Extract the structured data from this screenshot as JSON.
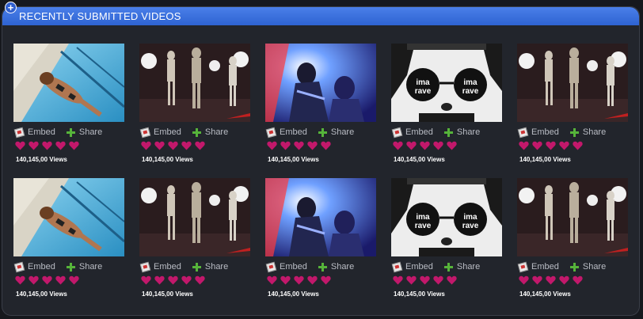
{
  "panel": {
    "title": "RECENTLY SUBMITTED VIDEOS",
    "header_color": "#3b70de",
    "expand_icon": "plus-icon"
  },
  "videos": [
    {
      "thumb": "pool",
      "embed_label": "Embed",
      "share_label": "Share",
      "rating": 5,
      "views": "140,145,00 Views"
    },
    {
      "thumb": "stage",
      "embed_label": "Embed",
      "share_label": "Share",
      "rating": 5,
      "views": "140,145,00 Views"
    },
    {
      "thumb": "club",
      "embed_label": "Embed",
      "share_label": "Share",
      "rating": 5,
      "views": "140,145,00 Views"
    },
    {
      "thumb": "rave",
      "embed_label": "Embed",
      "share_label": "Share",
      "rating": 5,
      "views": "140,145,00 Views"
    },
    {
      "thumb": "stage",
      "embed_label": "Embed",
      "share_label": "Share",
      "rating": 5,
      "views": "140,145,00 Views"
    },
    {
      "thumb": "pool",
      "embed_label": "Embed",
      "share_label": "Share",
      "rating": 5,
      "views": "140,145,00 Views"
    },
    {
      "thumb": "stage",
      "embed_label": "Embed",
      "share_label": "Share",
      "rating": 5,
      "views": "140,145,00 Views"
    },
    {
      "thumb": "club",
      "embed_label": "Embed",
      "share_label": "Share",
      "rating": 5,
      "views": "140,145,00 Views"
    },
    {
      "thumb": "rave",
      "embed_label": "Embed",
      "share_label": "Share",
      "rating": 5,
      "views": "140,145,00 Views"
    },
    {
      "thumb": "stage",
      "embed_label": "Embed",
      "share_label": "Share",
      "rating": 5,
      "views": "140,145,00 Views"
    }
  ],
  "thumb_texts": {
    "rave": "ima rave"
  },
  "colors": {
    "heart": "#c2186b",
    "share": "#56b43a"
  }
}
